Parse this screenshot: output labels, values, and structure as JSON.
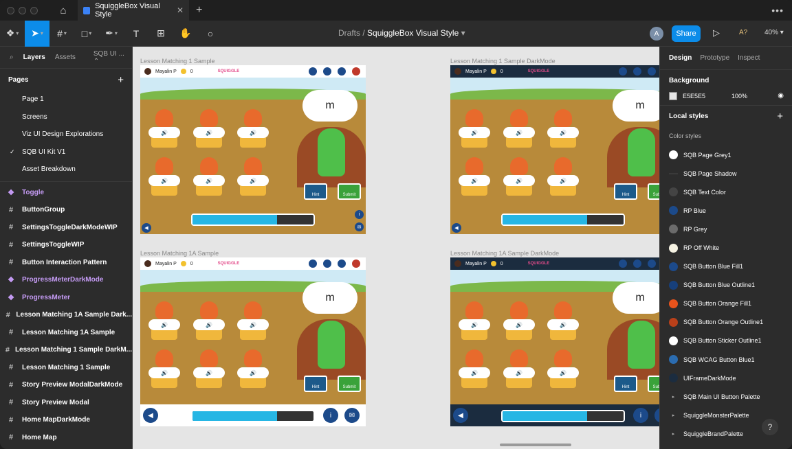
{
  "titlebar": {
    "tab_title": "SquiggleBox Visual Style"
  },
  "toolbar": {
    "crumb_parent": "Drafts",
    "crumb_sep": "/",
    "crumb_file": "SquiggleBox Visual Style",
    "avatar_initial": "A",
    "share_label": "Share",
    "access_label": "A?",
    "zoom_label": "40%"
  },
  "left": {
    "tab_layers": "Layers",
    "tab_assets": "Assets",
    "selector": "SQB UI ...",
    "pages_heading": "Pages",
    "pages": [
      "Page 1",
      "Screens",
      "Viz UI Design Explorations",
      "SQB UI Kit V1",
      "Asset Breakdown"
    ],
    "checked_page": "✓",
    "layers": [
      {
        "name": "Toggle",
        "kind": "component"
      },
      {
        "name": "ButtonGroup",
        "kind": "frame"
      },
      {
        "name": "SettingsToggleDarkModeWIP",
        "kind": "frame"
      },
      {
        "name": "SettingsToggleWIP",
        "kind": "frame"
      },
      {
        "name": "Button Interaction Pattern",
        "kind": "frame"
      },
      {
        "name": "ProgressMeterDarkMode",
        "kind": "component"
      },
      {
        "name": "ProgressMeter",
        "kind": "component"
      },
      {
        "name": "Lesson Matching 1A Sample Dark...",
        "kind": "frame"
      },
      {
        "name": "Lesson Matching 1A Sample",
        "kind": "frame"
      },
      {
        "name": "Lesson Matching 1 Sample DarkM...",
        "kind": "frame"
      },
      {
        "name": "Lesson Matching 1 Sample",
        "kind": "frame"
      },
      {
        "name": "Story Preview ModalDarkMode",
        "kind": "frame"
      },
      {
        "name": "Story Preview Modal",
        "kind": "frame"
      },
      {
        "name": "Home MapDarkMode",
        "kind": "frame"
      },
      {
        "name": "Home Map",
        "kind": "frame"
      }
    ]
  },
  "canvas": {
    "frames": [
      {
        "label": "Lesson Matching 1 Sample",
        "dark": false,
        "style": "1"
      },
      {
        "label": "Lesson Matching 1 Sample DarkMode",
        "dark": true,
        "style": "1"
      },
      {
        "label": "Lesson Matching 1A Sample",
        "dark": false,
        "style": "1A"
      },
      {
        "label": "Lesson Matching 1A Sample DarkMode",
        "dark": true,
        "style": "1A"
      }
    ],
    "game": {
      "user_name": "Mayalin P",
      "coins": "0",
      "logo": "SQUIGGLE",
      "letter": "m",
      "hint_label": "Hint",
      "submit_label": "Submit",
      "progress": 0.7
    }
  },
  "right": {
    "tab_design": "Design",
    "tab_prototype": "Prototype",
    "tab_inspect": "Inspect",
    "background_heading": "Background",
    "background_hex": "E5E5E5",
    "background_opacity": "100%",
    "local_styles_heading": "Local styles",
    "color_styles_heading": "Color styles",
    "styles": [
      {
        "name": "SQB Page Grey1",
        "color": "#ffffff",
        "type": "swatch"
      },
      {
        "name": "SQB Page Shadow",
        "color": "#3a3a3a",
        "type": "bar"
      },
      {
        "name": "SQB Text Color",
        "color": "#444444",
        "type": "swatch"
      },
      {
        "name": "RP Blue",
        "color": "#1c4a8a",
        "type": "swatch"
      },
      {
        "name": "RP Grey",
        "color": "#6b6b6b",
        "type": "swatch"
      },
      {
        "name": "RP Off White",
        "color": "#f6f3e3",
        "type": "swatch"
      },
      {
        "name": "SQB Button Blue Fill1",
        "color": "#1c4a8a",
        "type": "swatch"
      },
      {
        "name": "SQB Button Blue Outline1",
        "color": "#173f7a",
        "type": "swatch"
      },
      {
        "name": "SQB Button Orange Fill1",
        "color": "#e8531c",
        "type": "swatch"
      },
      {
        "name": "SQB Button Orange Outline1",
        "color": "#b9401a",
        "type": "swatch"
      },
      {
        "name": "SQB Button Sticker Outline1",
        "color": "#ffffff",
        "type": "swatch"
      },
      {
        "name": "SQB WCAG Button Blue1",
        "color": "#2b6cb0",
        "type": "swatch"
      },
      {
        "name": "UIFrameDarkMode",
        "color": "#1b2c3f",
        "type": "swatch"
      },
      {
        "name": "SQB Main UI Button Palette",
        "color": "",
        "type": "group"
      },
      {
        "name": "SquiggleMonsterPalette",
        "color": "",
        "type": "group"
      },
      {
        "name": "SquiggleBrandPalette",
        "color": "",
        "type": "group"
      }
    ],
    "help": "?"
  }
}
